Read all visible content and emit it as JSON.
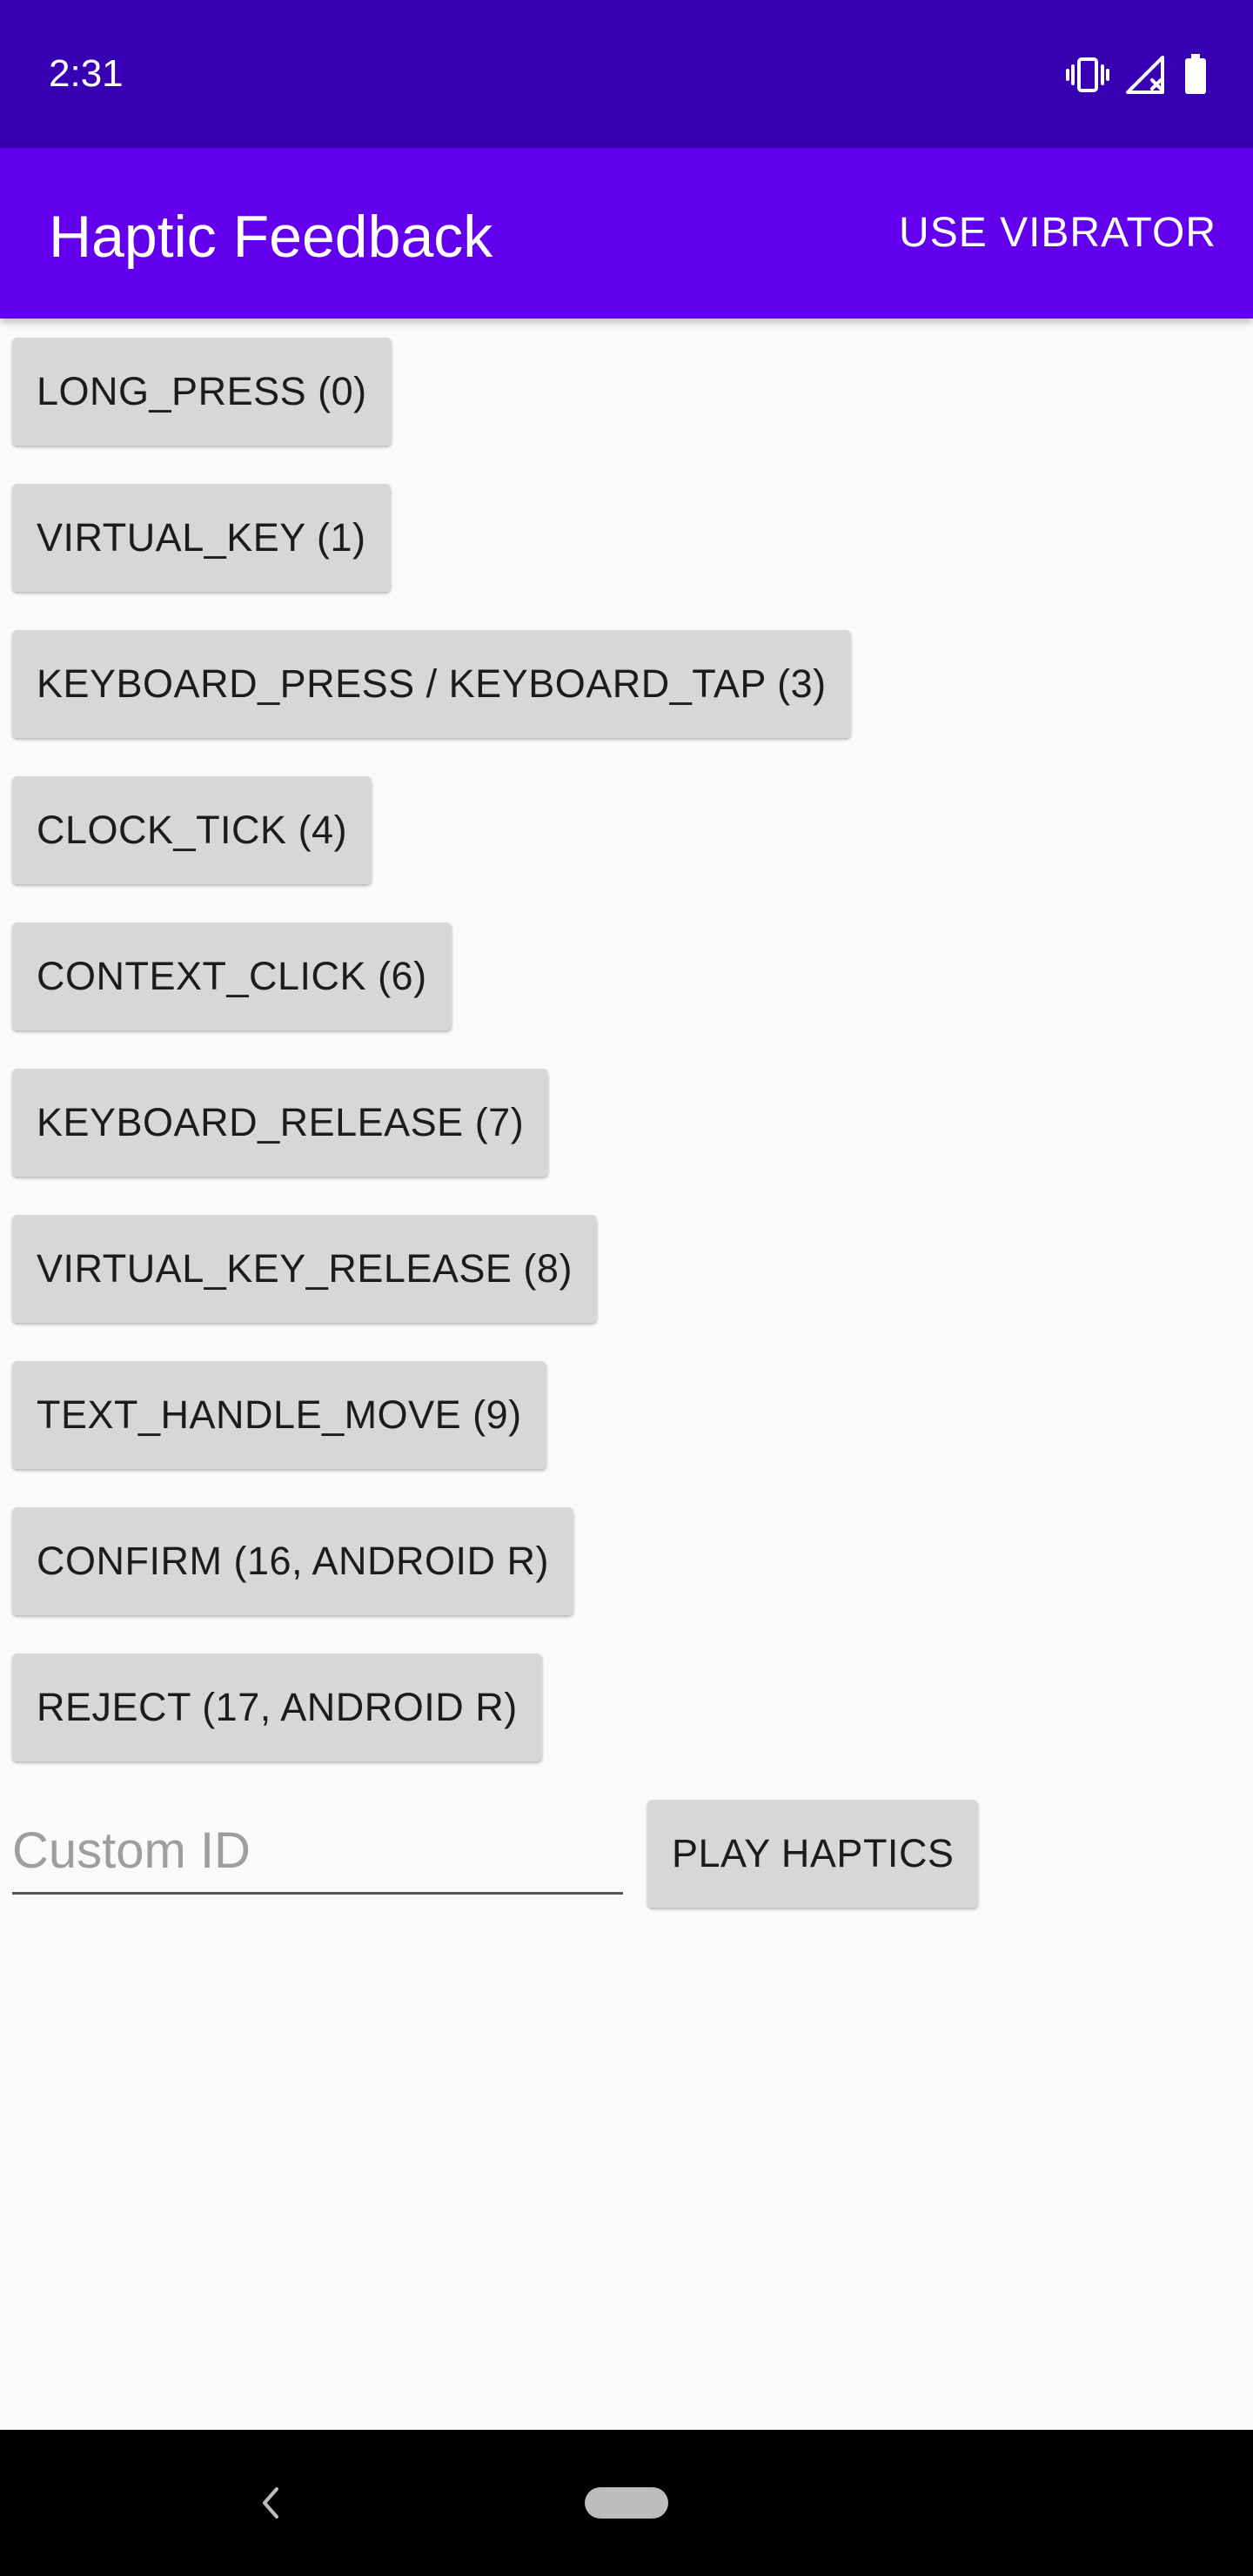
{
  "status_bar": {
    "time": "2:31",
    "icons": [
      "vibrate-icon",
      "signal-off-icon",
      "battery-icon"
    ]
  },
  "app_bar": {
    "title": "Haptic Feedback",
    "action": "USE VIBRATOR"
  },
  "buttons": [
    "LONG_PRESS (0)",
    "VIRTUAL_KEY (1)",
    "KEYBOARD_PRESS / KEYBOARD_TAP (3)",
    "CLOCK_TICK (4)",
    "CONTEXT_CLICK (6)",
    "KEYBOARD_RELEASE (7)",
    "VIRTUAL_KEY_RELEASE (8)",
    "TEXT_HANDLE_MOVE (9)",
    "CONFIRM (16, ANDROID R)",
    "REJECT (17, ANDROID R)"
  ],
  "custom": {
    "placeholder": "Custom ID",
    "value": "",
    "play_label": "PLAY HAPTICS"
  },
  "nav": {
    "icons": [
      "back-icon",
      "home-pill-icon"
    ]
  },
  "colors": {
    "status_bar": "#3700b3",
    "app_bar": "#6200ee",
    "button_bg": "#d6d7d7",
    "background": "#fafafa"
  }
}
